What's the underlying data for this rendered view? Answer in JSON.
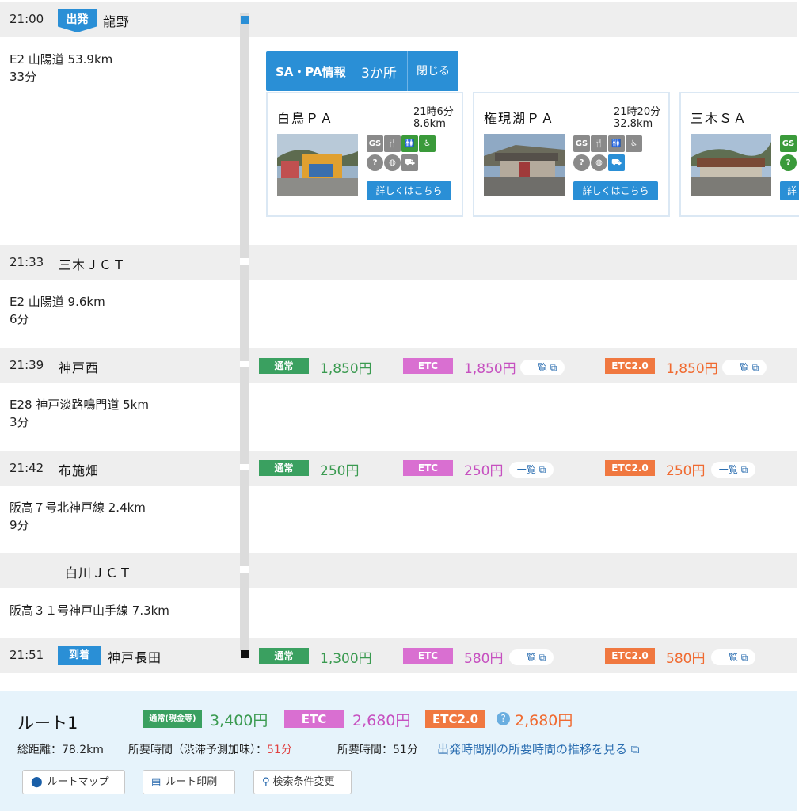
{
  "rows": {
    "r1": {
      "time": "21:00",
      "badge": "出発",
      "place": "龍野"
    },
    "seg1": {
      "road": "E2 山陽道 53.9km",
      "dur": "33分"
    },
    "r2": {
      "time": "21:33",
      "place": "三木ＪＣＴ"
    },
    "seg2": {
      "road": "E2 山陽道 9.6km",
      "dur": "6分"
    },
    "r3": {
      "time": "21:39",
      "place": "神戸西"
    },
    "seg3": {
      "road": "E28 神戸淡路鳴門道 5km",
      "dur": "3分"
    },
    "r4": {
      "time": "21:42",
      "place": "布施畑"
    },
    "seg4": {
      "road": "阪高７号北神戸線 2.4km",
      "dur": "9分"
    },
    "r5": {
      "place": "白川ＪＣＴ"
    },
    "seg5": {
      "road": "阪高３１号神戸山手線 7.3km"
    },
    "r6": {
      "time": "21:51",
      "badge": "到着",
      "place": "神戸長田"
    }
  },
  "sapa": {
    "title": "SA・PA情報",
    "count": "3か所",
    "close": "閉じる",
    "cards": [
      {
        "name": "白鳥ＰＡ",
        "time": "21時6分",
        "dist": "8.6km",
        "more": "詳しくはこちら",
        "icons": [
          "GS",
          "restaurant-icon",
          "toilet-icon",
          "accessible-icon",
          "info-icon",
          "vending-icon",
          "ev-icon"
        ]
      },
      {
        "name": "権現湖ＰＡ",
        "time": "21時20分",
        "dist": "32.8km",
        "more": "詳しくはこちら",
        "icons": [
          "GS",
          "restaurant-icon",
          "toilet-icon",
          "accessible-icon",
          "info-icon",
          "vending-icon",
          "ev-icon"
        ]
      },
      {
        "name": "三木ＳＡ",
        "more": "詳",
        "icons": [
          "GS",
          "info-icon"
        ]
      }
    ]
  },
  "fares": {
    "labels": {
      "normal": "通常",
      "etc": "ETC",
      "etc2": "ETC2.0",
      "list": "一覧"
    },
    "r3": {
      "normal": "1,850円",
      "etc": "1,850円",
      "etc2": "1,850円"
    },
    "r4": {
      "normal": "250円",
      "etc": "250円",
      "etc2": "250円"
    },
    "r6": {
      "normal": "1,300円",
      "etc": "580円",
      "etc2": "580円"
    }
  },
  "summary": {
    "route": "ルート1",
    "normal_label": "通常(現金等)",
    "normal_price": "3,400円",
    "etc_label": "ETC",
    "etc_price": "2,680円",
    "etc2_label": "ETC2.0",
    "etc2_price": "2,680円",
    "distance": "総距離：78.2km",
    "time_jam_label": "所要時間（渋滞予測加味）：",
    "time_jam": "51分",
    "time": "所要時間：51分",
    "trend_link": "出発時間別の所要時間の推移を見る",
    "btn_map": "ルートマップ",
    "btn_print": "ルート印刷",
    "btn_change": "検索条件変更"
  },
  "colors": {
    "accent": "#2a8fd6",
    "normal": "#3aa060",
    "etc": "#d96fd1",
    "etc2": "#f07840"
  }
}
